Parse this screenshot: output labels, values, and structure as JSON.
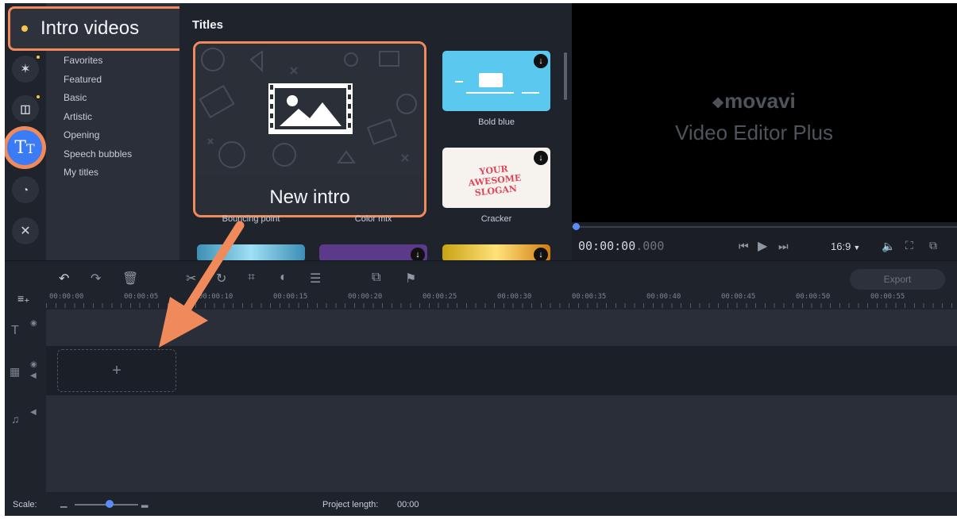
{
  "tab": {
    "label": "Intro videos"
  },
  "sidebar": {
    "categories": [
      "Favorites",
      "Featured",
      "Basic",
      "Artistic",
      "Opening",
      "Speech bubbles",
      "My titles"
    ]
  },
  "gallery": {
    "heading": "Titles",
    "highlight_label": "New intro",
    "tiles": [
      {
        "caption": "Bold blue"
      },
      {
        "caption": "Cracker",
        "text": "YOUR AWESOME SLOGAN"
      },
      {
        "caption": "Bouncing point"
      },
      {
        "caption": "Color mix"
      }
    ]
  },
  "player": {
    "brand": "movavi",
    "product": "Video Editor Plus",
    "time_main": "00:00:00",
    "time_ms": ".000",
    "aspect": "16:9"
  },
  "toolbar": {
    "export_label": "Export"
  },
  "ruler": {
    "ticks": [
      "00:00:00",
      "00:00:05",
      "00:00:10",
      "00:00:15",
      "00:00:20",
      "00:00:25",
      "00:00:30",
      "00:00:35",
      "00:00:40",
      "00:00:45",
      "00:00:50",
      "00:00:55"
    ]
  },
  "timeline": {
    "add_symbol": "+"
  },
  "status": {
    "scale_label": "Scale:",
    "project_length_label": "Project length:",
    "project_length_value": "00:00",
    "scale_level": 0.55
  },
  "colors": {
    "accent": "#f08a5a",
    "selected_tool": "#3b7bf5",
    "bg": "#1f232c"
  }
}
